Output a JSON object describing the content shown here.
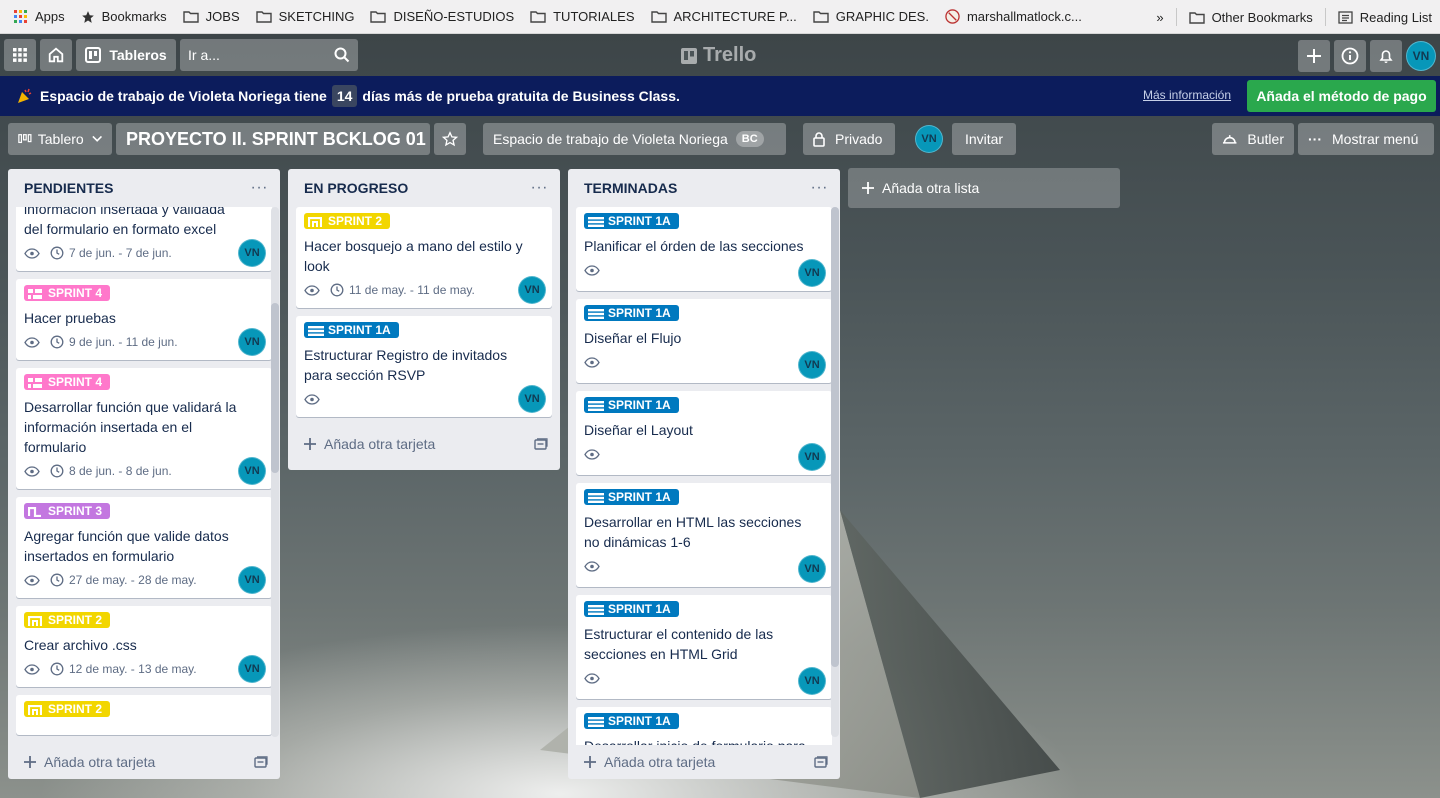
{
  "bookmarks": {
    "left": [
      {
        "label": "Apps",
        "icon": "apps-grid-icon"
      },
      {
        "label": "Bookmarks",
        "icon": "star-icon"
      },
      {
        "label": "JOBS",
        "icon": "folder-icon"
      },
      {
        "label": "SKETCHING",
        "icon": "folder-icon"
      },
      {
        "label": "DISEÑO-ESTUDIOS",
        "icon": "folder-icon"
      },
      {
        "label": "TUTORIALES",
        "icon": "folder-icon"
      },
      {
        "label": "ARCHITECTURE P...",
        "icon": "folder-icon"
      },
      {
        "label": "GRAPHIC DES.",
        "icon": "folder-icon"
      },
      {
        "label": "marshallmatlock.c...",
        "icon": "site-icon"
      }
    ],
    "overflow": "»",
    "other": "Other Bookmarks",
    "reading_list": "Reading List"
  },
  "header": {
    "boards_label": "Tableros",
    "search_placeholder": "Ir a...",
    "logo": "Trello",
    "avatar": "VN"
  },
  "banner": {
    "text_before": "Espacio de trabajo de Violeta Noriega tiene",
    "days": "14",
    "text_after": "días más de prueba gratuita de Business Class.",
    "more_info": "Más información",
    "cta": "Añada el método de pago"
  },
  "board": {
    "view": "Tablero",
    "title": "PROYECTO II. SPRINT BCKLOG 01",
    "workspace": "Espacio de trabajo de Violeta Noriega",
    "workspace_badge": "BC",
    "privacy": "Privado",
    "member": "VN",
    "invite": "Invitar",
    "butler": "Butler",
    "menu": "Mostrar menú",
    "add_list": "Añada otra lista"
  },
  "colors": {
    "sprint4": "#ff78cb",
    "sprint3": "#c377e0",
    "sprint2": "#f2d600",
    "sprint1a": "#0079bf"
  },
  "lists": [
    {
      "title": "PENDIENTES",
      "add_card": "Añada otra tarjeta",
      "cards": [
        {
          "label": "",
          "title": "información insertada y validada del formulario en formato excel",
          "dates": "7 de jun. - 7 de jun.",
          "member": "VN"
        },
        {
          "label": "SPRINT 4",
          "title": "Hacer pruebas",
          "dates": "9 de jun. - 11 de jun.",
          "member": "VN"
        },
        {
          "label": "SPRINT 4",
          "title": "Desarrollar función que validará la información insertada en el formulario",
          "dates": "8 de jun. - 8 de jun.",
          "member": "VN"
        },
        {
          "label": "SPRINT 3",
          "title": "Agregar función que valide datos insertados en formulario",
          "dates": "27 de may. - 28 de may.",
          "member": "VN"
        },
        {
          "label": "SPRINT 2",
          "title": "Crear archivo .css",
          "dates": "12 de may. - 13 de may.",
          "member": "VN"
        },
        {
          "label": "SPRINT 2",
          "title": "",
          "dates": "",
          "member": ""
        }
      ]
    },
    {
      "title": "EN PROGRESO",
      "add_card": "Añada otra tarjeta",
      "cards": [
        {
          "label": "SPRINT 2",
          "title": "Hacer bosquejo a mano del estilo y look",
          "dates": "11 de may. - 11 de may.",
          "member": "VN"
        },
        {
          "label": "SPRINT 1A",
          "title": "Estructurar Registro de invitados para sección RSVP",
          "dates": "",
          "member": "VN"
        }
      ]
    },
    {
      "title": "TERMINADAS",
      "add_card": "Añada otra tarjeta",
      "cards": [
        {
          "label": "SPRINT 1A",
          "title": "Planificar el órden de las secciones",
          "member": "VN"
        },
        {
          "label": "SPRINT 1A",
          "title": "Diseñar el Flujo",
          "member": "VN"
        },
        {
          "label": "SPRINT 1A",
          "title": "Diseñar el Layout",
          "member": "VN"
        },
        {
          "label": "SPRINT 1A",
          "title": "Desarrollar en HTML las secciones no dinámicas 1-6",
          "member": "VN"
        },
        {
          "label": "SPRINT 1A",
          "title": "Estructurar el contenido de las secciones en HTML Grid",
          "member": "VN"
        },
        {
          "label": "SPRINT 1A",
          "title": "Desarrollar inicio de formulario para",
          "member": ""
        }
      ]
    }
  ]
}
